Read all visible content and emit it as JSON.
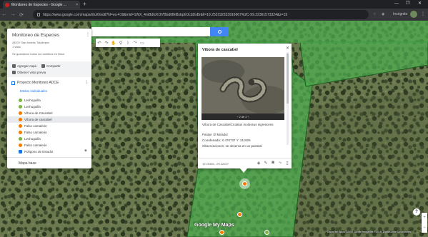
{
  "browser": {
    "tab_title": "Monitoreo de Especies - Google ...",
    "tab_close": "×",
    "new_tab": "+",
    "url": "https://www.google.com/maps/d/u/0/edit?hl=es-419&mid=1WX_4mBdIcKOl7Bbd6fEl8xbphOcbDsBr&ll=19.253192333916667%2C-99.22361573324&z=19",
    "incognito_label": "Incógnito",
    "window_controls": [
      "—",
      "❐",
      "✕"
    ]
  },
  "panel": {
    "title": "Monitoreo de Especies",
    "subtitle_line1": "ADCE San Andrés Totoltepec",
    "subtitle_line2": "1 vista",
    "autosave_note": "Se guardaron todos los cambios en Drive",
    "add_layer": "Agregar capa",
    "share": "Compartir",
    "preview": "Obtener vista previa",
    "layer_name": "Proyecto Monitoreo ADCE",
    "sublayer": "Estilos individuales",
    "items": [
      {
        "label": "Lechuguilla",
        "color": "#7cb342"
      },
      {
        "label": "Lechuguilla",
        "color": "#7cb342"
      },
      {
        "label": "Víbora de Cascabel",
        "color": "#f57c00"
      },
      {
        "label": "Víbora de cascabel",
        "color": "#f57c00"
      },
      {
        "label": "Falso camaleón",
        "color": "#f57c00"
      },
      {
        "label": "Falso camaleón",
        "color": "#f57c00"
      },
      {
        "label": "Lechuguilla",
        "color": "#7cb342"
      },
      {
        "label": "Falso camaleón",
        "color": "#f57c00"
      },
      {
        "label": "Polígono de Estudio",
        "color": "#1a73e8"
      }
    ],
    "basemap": "Mapa base"
  },
  "info_window": {
    "title": "Víbora de cascabel",
    "photo_counter": "2 de 2",
    "species": "Víbora de CascabelCrotalus molossus nigrescens",
    "place": "Paraje: El Mirador",
    "coordinates": "Coordenada: X:470737 Y: 211926",
    "observations": "Observaciones: se observa en un pastizal",
    "latlng": "19.25365, -99.22637"
  },
  "map": {
    "google_logo": "Google My Maps",
    "attribution": "Datos del mapa ©2019 Google Imágenes ©2019, DigitalGlobe  Condiciones",
    "help": "?",
    "zoom_in": "+",
    "zoom_out": "−"
  },
  "colors": {
    "polygon_fill": "#4caf50",
    "accent": "#4285f4",
    "marker_orange": "#f57c00",
    "marker_green": "#7cb342"
  }
}
